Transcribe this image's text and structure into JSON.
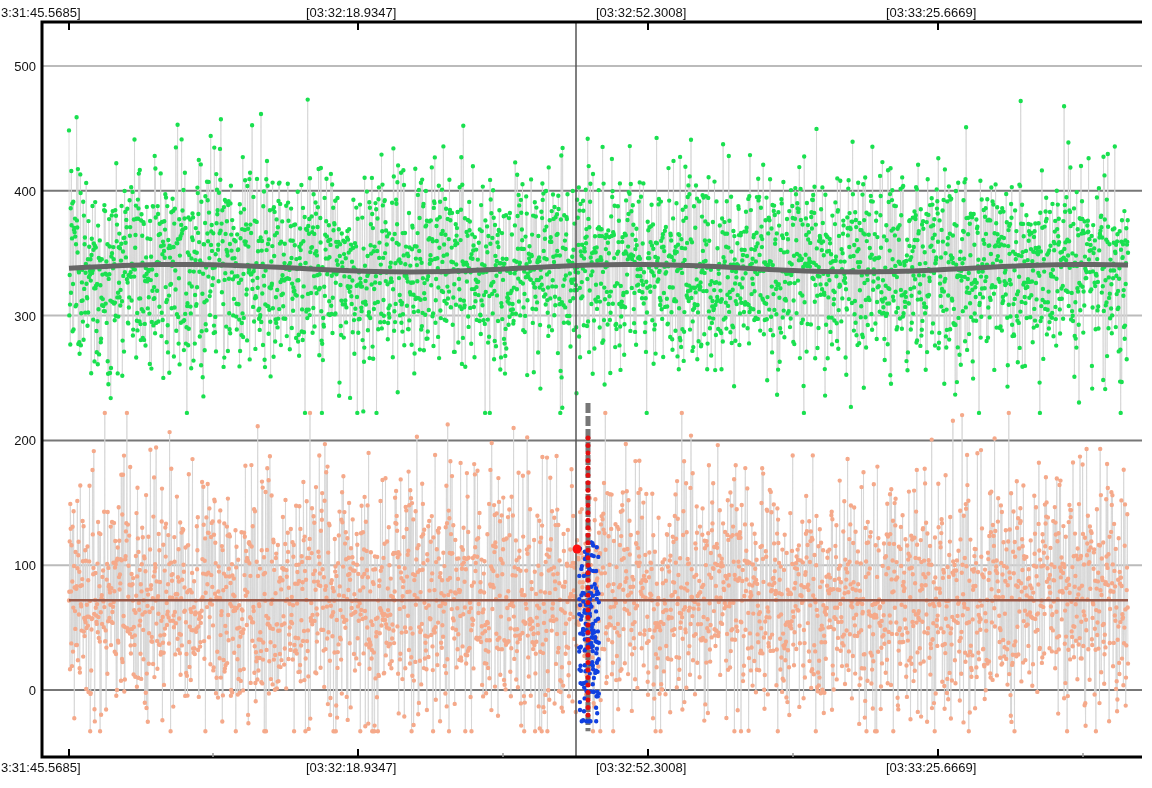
{
  "plot": {
    "top_labels": [
      "3:31:45.5685]",
      "[03:32:18.9347]",
      "[03:32:52.3008]",
      "[03:33:25.6669]"
    ],
    "bottom_labels": [
      "3:31:45.5685]",
      "[03:32:18.9347]",
      "[03:32:52.3008]",
      "[03:33:25.6669]"
    ],
    "y_labels": [
      "500",
      "400",
      "300",
      "200",
      "100",
      "0"
    ]
  }
}
